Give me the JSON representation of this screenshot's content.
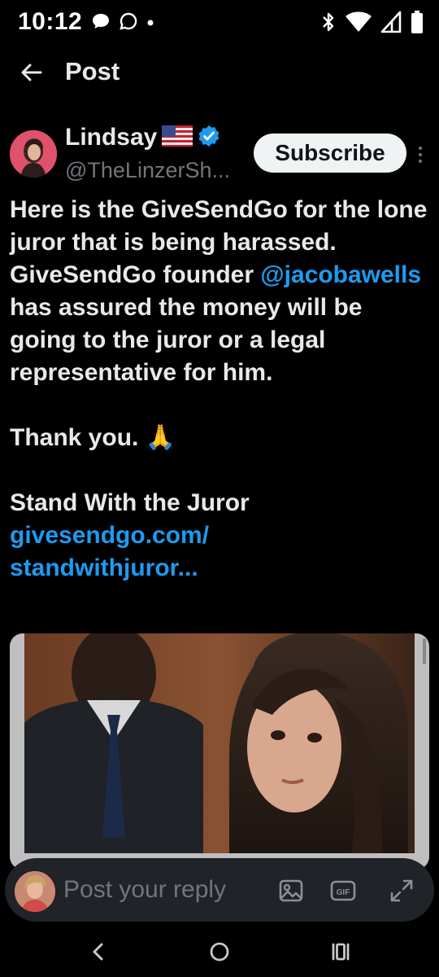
{
  "status_bar": {
    "time": "10:12",
    "left_icons": [
      "chat-bubble-icon",
      "message-outline-icon",
      "dot-icon"
    ],
    "right_icons": [
      "bluetooth-icon",
      "wifi-icon",
      "signal-icon",
      "battery-icon"
    ]
  },
  "header": {
    "title": "Post",
    "back_icon": "arrow-left-icon"
  },
  "author": {
    "name": "Lindsay",
    "flag_icon": "us-flag-icon",
    "verified_icon": "verified-badge-icon",
    "handle": "@TheLinzerSh...",
    "subscribe_label": "Subscribe",
    "more_icon": "more-vertical-icon"
  },
  "tweet": {
    "line1": "Here is the GiveSendGo for the lone juror that is being harassed. GiveSendGo founder",
    "mention": "@jacobawells",
    "line2": " has assured the money will be going to the juror or a legal representative for him.",
    "thanks": "Thank you. 🙏",
    "stand": "Stand With the Juror",
    "link_line1": "givesendgo.com/",
    "link_line2": "standwithjuror..."
  },
  "reply": {
    "placeholder": "Post your reply",
    "icons": [
      "image-icon",
      "gif-icon",
      "expand-icon"
    ],
    "gif_label": "GIF"
  },
  "nav": {
    "icons": [
      "nav-back-icon",
      "nav-home-icon",
      "nav-recents-icon"
    ]
  },
  "colors": {
    "accent": "#1d9bf0",
    "background": "#000000",
    "text": "#e7e9ea",
    "muted": "#71767b"
  }
}
